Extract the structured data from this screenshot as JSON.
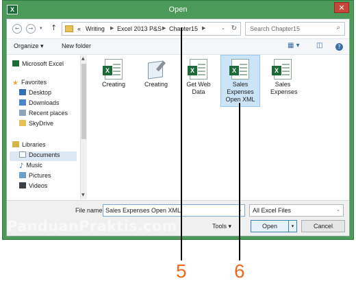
{
  "window": {
    "title": "Open",
    "app_icon_text": "X",
    "close_glyph": "✕"
  },
  "address": {
    "back_glyph": "←",
    "forward_glyph": "→",
    "history_glyph": "▾",
    "up_glyph": "↑",
    "prefix": "«",
    "crumbs": [
      "Writing",
      "Excel 2013 P&S",
      "Chapter15"
    ],
    "separator": "▶",
    "dropdown_glyph": "⌄",
    "refresh_glyph": "↻",
    "search_placeholder": "Search Chapter15",
    "search_glyph": "⌕"
  },
  "toolbar": {
    "organize": "Organize ▾",
    "new_folder": "New folder",
    "view_glyph": "▦ ▾",
    "pane_glyph": "◫",
    "help_glyph": "?"
  },
  "nav": {
    "items": [
      {
        "label": "Microsoft Excel",
        "icon": "excel-icon"
      },
      {
        "label": "Favorites",
        "icon": "star-icon"
      },
      {
        "label": "Desktop",
        "icon": "desktop-icon"
      },
      {
        "label": "Downloads",
        "icon": "downloads-icon"
      },
      {
        "label": "Recent places",
        "icon": "recent-icon"
      },
      {
        "label": "SkyDrive",
        "icon": "skydrive-icon"
      },
      {
        "label": "Libraries",
        "icon": "libraries-icon"
      },
      {
        "label": "Documents",
        "icon": "documents-icon"
      },
      {
        "label": "Music",
        "icon": "music-icon"
      },
      {
        "label": "Pictures",
        "icon": "pictures-icon"
      },
      {
        "label": "Videos",
        "icon": "videos-icon"
      }
    ],
    "scroll_up": "▲",
    "scroll_down": "▼"
  },
  "files": [
    {
      "label": "Creating",
      "icon": "excel-file-icon"
    },
    {
      "label": "Creating",
      "icon": "notepad-file-icon"
    },
    {
      "label": "Get Web Data",
      "icon": "excel-file-icon"
    },
    {
      "label": "Sales Expenses Open XML",
      "icon": "excel-file-icon",
      "selected": true
    },
    {
      "label": "Sales Expenses",
      "icon": "excel-file-icon"
    }
  ],
  "excel_badge": "X",
  "bottom": {
    "file_name_label": "File name:",
    "file_name_value": "Sales Expenses Open XML",
    "file_type_value": "All Excel Files",
    "dropdown_glyph": "⌄",
    "tools_label": "Tools ▾",
    "open_label": "Open",
    "open_split_glyph": "▾",
    "cancel_label": "Cancel"
  },
  "watermark": "PanduanPraktis.com",
  "callouts": [
    "5",
    "6"
  ],
  "colors": {
    "titlebar": "#4b9a5a",
    "callout": "#ef6a1f",
    "selection": "#cce4f7"
  }
}
